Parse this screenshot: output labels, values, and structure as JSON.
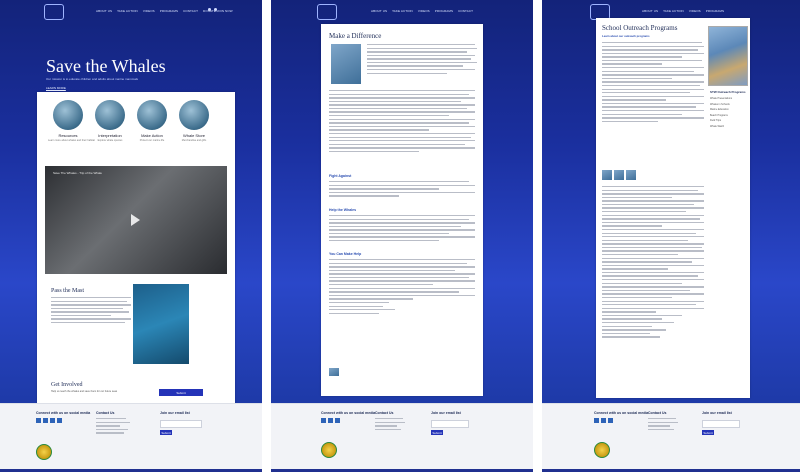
{
  "nav": {
    "menu": [
      "ABOUT US",
      "TAKE ACTION",
      "VIDEOS",
      "PROGRAMS",
      "CONTACT",
      "DONATE/JOIN NOW"
    ]
  },
  "home": {
    "hero_title": "Save the Whales",
    "hero_sub": "Our mission is to educate children and adults about marine mammals",
    "hero_link": "LEARN MORE",
    "features": [
      {
        "title": "Resources",
        "text": "Learn more about whales and their habitat"
      },
      {
        "title": "Interpretation",
        "text": "Explore whale species"
      },
      {
        "title": "Make Action",
        "text": "Protect our marine life"
      },
      {
        "title": "Whale Store",
        "text": "Merchandise and gifts"
      }
    ],
    "video_title": "Save The Whales - Trip of the Whale",
    "pass_title": "Pass the Mast",
    "get_involved_title": "Get Involved",
    "get_involved_text": "Help us reach the whales and save them for our future seas",
    "get_involved_button": "Submit"
  },
  "article": {
    "title": "Make a Difference",
    "heading1": "Fight Against",
    "heading2": "Help the Whales",
    "heading3": "You Can Make Help"
  },
  "outreach": {
    "title": "School Outreach Programs",
    "sub": "Learn about our outreach programs",
    "sidebar_title": "STW Outreach Programs",
    "sidebar_items": [
      "Whale Presentations",
      "Whales in Schools",
      "Marine Education",
      "Beach Programs",
      "Field Trips",
      "Whale Watch"
    ]
  },
  "footer": {
    "col1_head": "Connect with us on social media",
    "col2_head": "Contact Us",
    "col3_head": "Join our email list",
    "col3_button": "Submit"
  },
  "colors": {
    "accent": "#2433b8",
    "hero": "#1a2f9e"
  }
}
